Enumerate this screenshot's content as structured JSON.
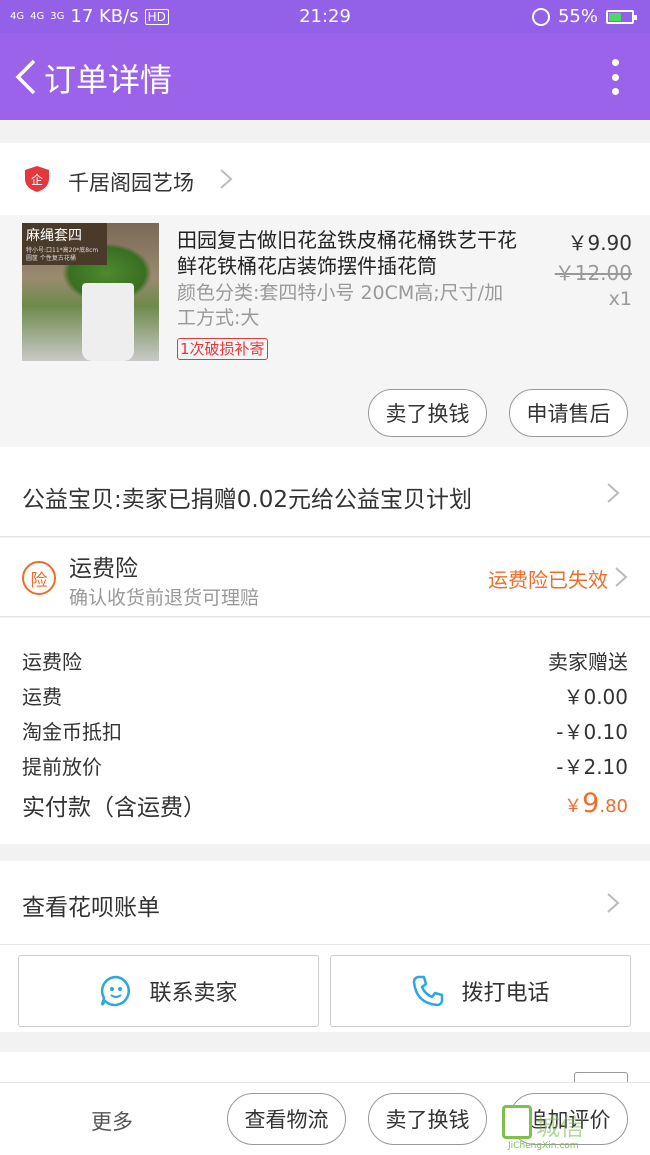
{
  "status_bar": {
    "signal1": "4G",
    "signal2": "4G",
    "signal3": "3G",
    "speed": "17 KB/s",
    "hd": "HD",
    "time": "21:29",
    "battery": "55%",
    "battery_level": 0.55
  },
  "nav": {
    "title": "订单详情"
  },
  "shop": {
    "name": "千居阁园艺场",
    "badge": "企"
  },
  "product": {
    "thumb_tag": "麻绳套四",
    "thumb_sub": "特小号:口11*高20*底8cm",
    "thumb_sub2": "圆筐 个性复古花桶",
    "title": "田园复古做旧花盆铁皮桶花桶铁艺干花鲜花铁桶花店装饰摆件插花筒",
    "sku": "颜色分类:套四特小号 20CM高;尺寸/加工方式:大",
    "badge": "1次破损补寄",
    "price": "￥9.90",
    "original_price": "￥12.00",
    "quantity": "x1",
    "btn_sell": "卖了换钱",
    "btn_aftersale": "申请售后"
  },
  "charity": {
    "text": "公益宝贝:卖家已捐赠0.02元给公益宝贝计划"
  },
  "insurance": {
    "icon_text": "险",
    "title": "运费险",
    "subtitle": "确认收货前退货可理赔",
    "status": "运费险已失效"
  },
  "fees": {
    "rows": [
      {
        "label": "运费险",
        "value": "卖家赠送"
      },
      {
        "label": "运费",
        "value": "￥0.00"
      },
      {
        "label": "淘金币抵扣",
        "value": "-￥0.10"
      },
      {
        "label": "提前放价",
        "value": "-￥2.10"
      }
    ],
    "total_label": "实付款（含运费）",
    "total_currency": "￥",
    "total_int": "9",
    "total_dec": ".80"
  },
  "huabei": {
    "text": "查看花呗账单"
  },
  "contact": {
    "seller": "联系卖家",
    "phone": "拨打电话"
  },
  "bottom": {
    "more": "更多",
    "logistics": "查看物流",
    "sell": "卖了换钱",
    "review": "追加评价"
  },
  "watermark": {
    "text": "城信",
    "url": "JiChengXin.com"
  },
  "colors": {
    "header": "#9b63ea",
    "accent": "#ef6c2b",
    "red": "#e4393c"
  }
}
